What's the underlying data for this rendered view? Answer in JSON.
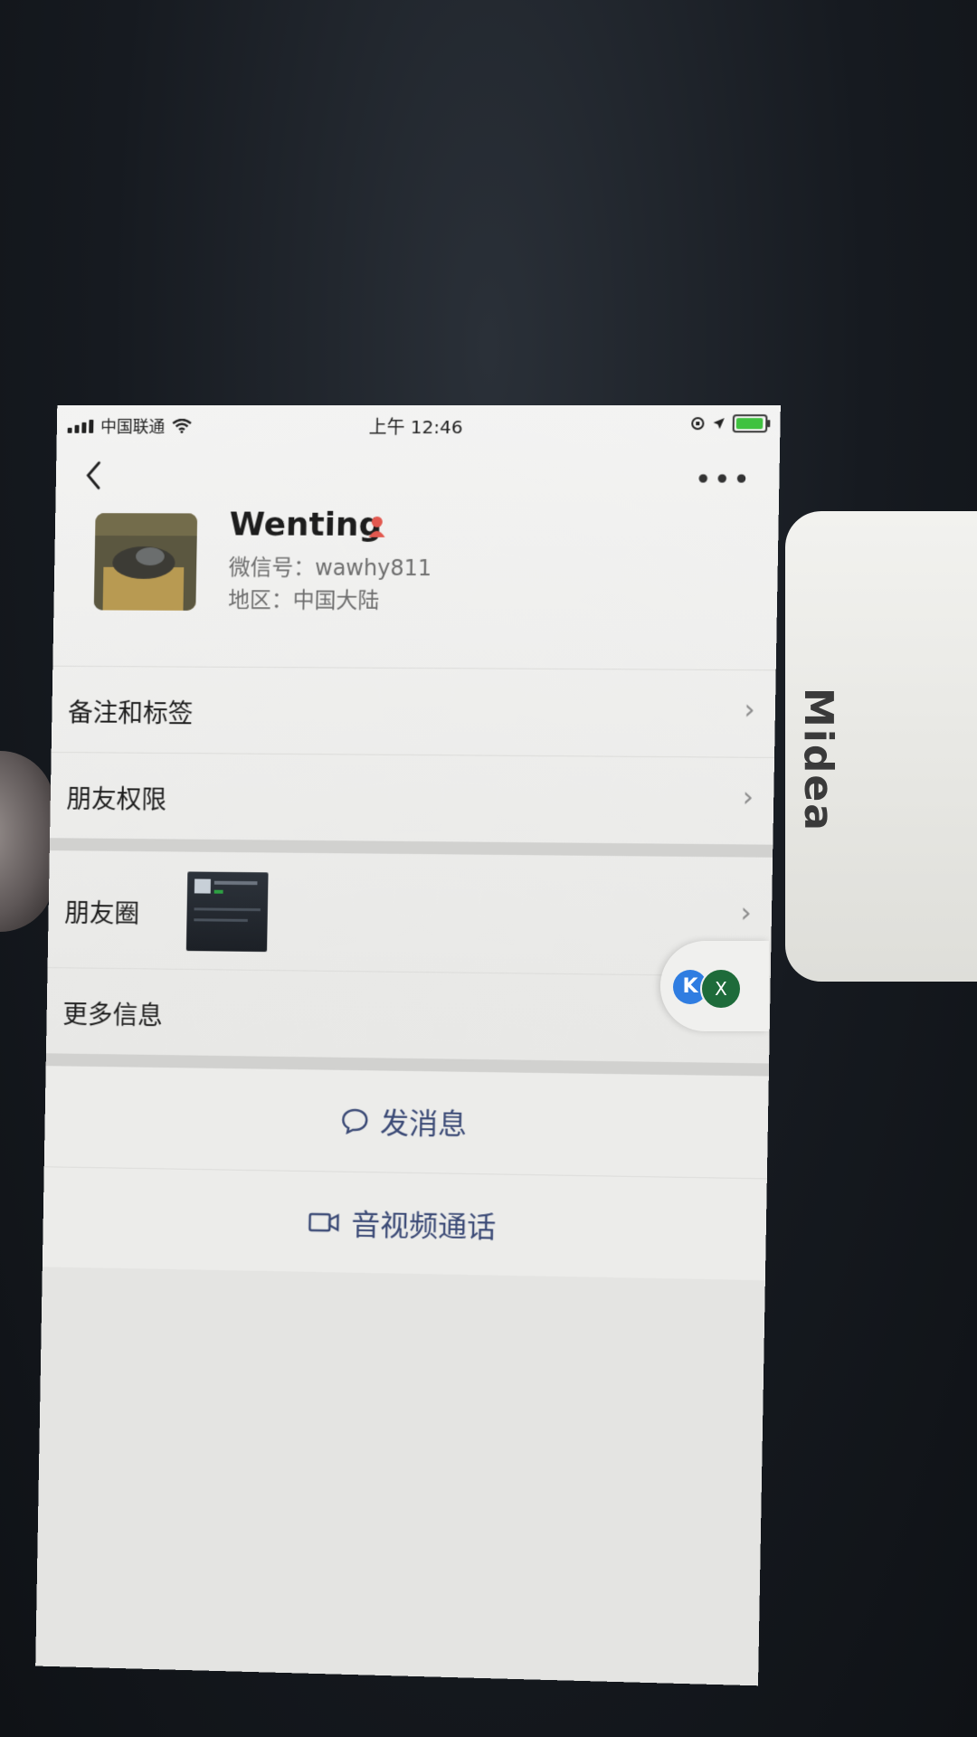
{
  "status_bar": {
    "carrier": "中国联通",
    "time": "上午 12:46",
    "battery_level": 0.85
  },
  "nav": {
    "back_icon": "chevron-left-icon",
    "more_icon": "more-icon",
    "more_glyph": "•••"
  },
  "profile": {
    "name": "Wenting",
    "wechat_id": "微信号：wawhy811",
    "region": "地区：中国大陆",
    "gender_icon_color": "#e2584f"
  },
  "menu": {
    "remarks_tags": "备注和标签",
    "friend_permissions": "朋友权限",
    "moments": "朋友圈",
    "more_info": "更多信息"
  },
  "actions": {
    "send_message": "发消息",
    "video_call": "音视频通话",
    "accent_color": "#3b4a76"
  },
  "floating_ball": {
    "k_label": "K",
    "x_label": "X"
  },
  "background_brand": "Midea"
}
